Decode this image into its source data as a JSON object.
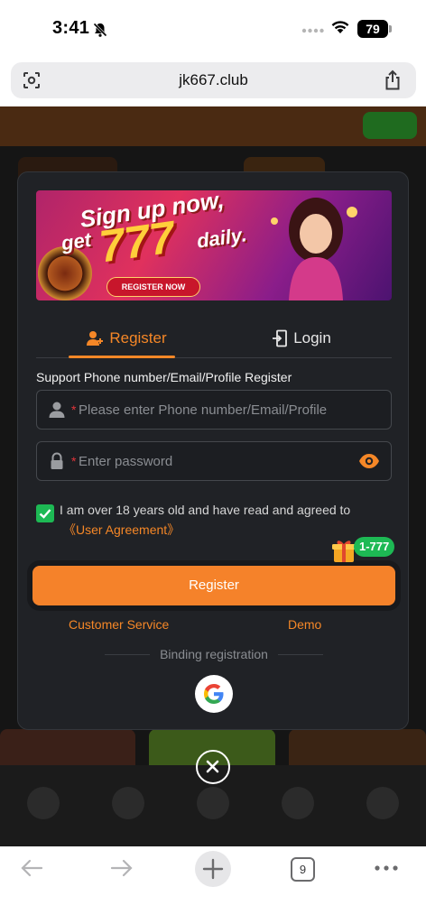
{
  "status_bar": {
    "time": "3:41",
    "battery": "79"
  },
  "browser": {
    "url": "jk667.club",
    "tab_count": "9"
  },
  "banner": {
    "headline": "Sign up now,",
    "get": "get",
    "amount": "777",
    "daily": "daily.",
    "cta": "REGISTER NOW"
  },
  "tabs": {
    "register": "Register",
    "login": "Login",
    "active": "register"
  },
  "form": {
    "support_label": "Support Phone number/Email/Profile Register",
    "phone_placeholder": "Please enter Phone number/Email/Profile",
    "password_placeholder": "Enter password",
    "required_mark": "*",
    "agree_checked": true,
    "agree_text": "I am over 18 years old and have read and agreed to",
    "agreement_link": "《User Agreement》",
    "register_button": "Register",
    "gift_badge": "1-777"
  },
  "links": {
    "customer_service": "Customer Service",
    "demo": "Demo"
  },
  "binding": {
    "label": "Binding registration",
    "providers": [
      "google"
    ]
  },
  "colors": {
    "accent": "#f58727",
    "success": "#1db954",
    "modal_bg": "#202226"
  }
}
